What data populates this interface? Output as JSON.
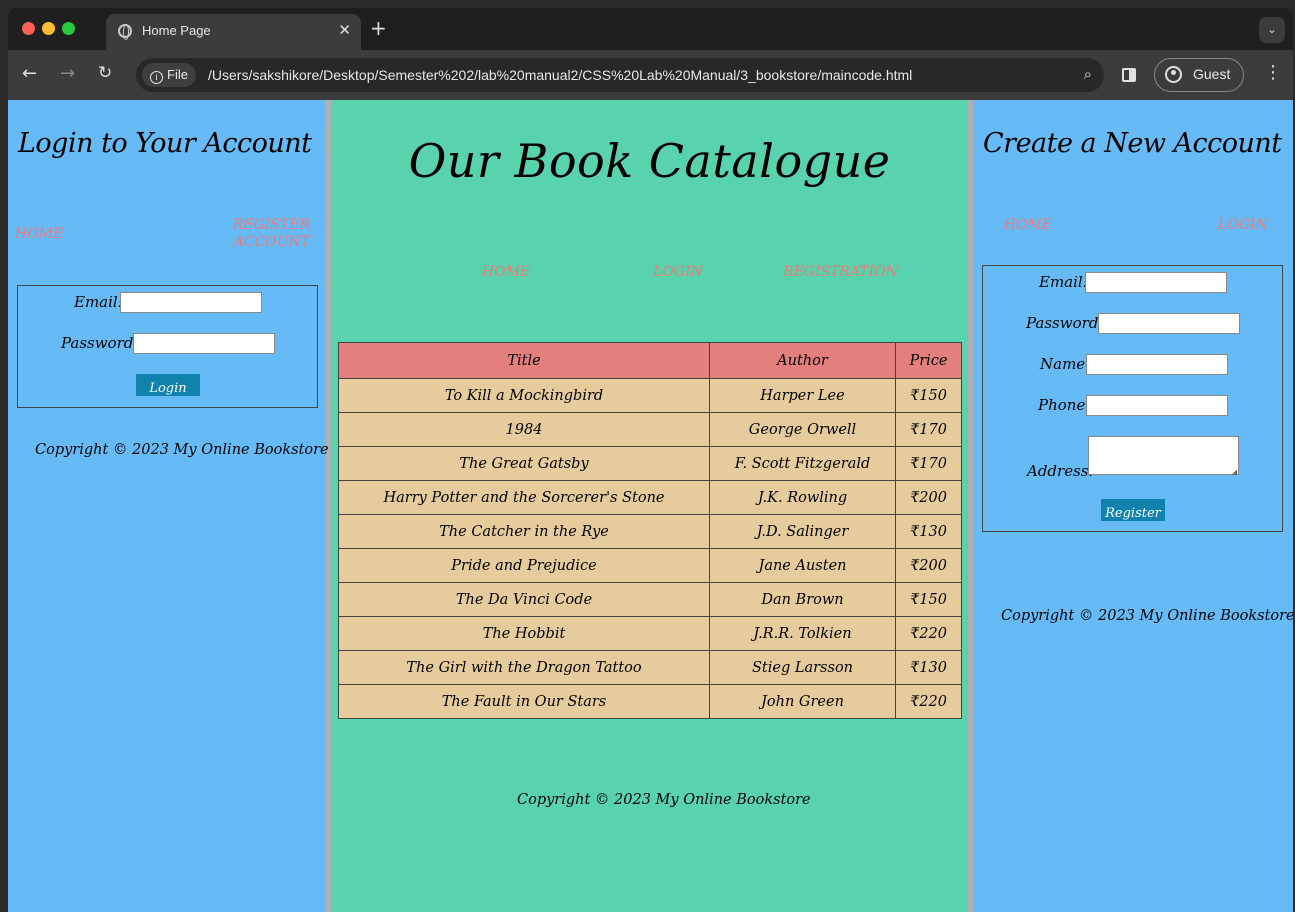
{
  "browser": {
    "tab_title": "Home Page",
    "tab_close": "✕",
    "new_tab": "+",
    "tab_menu": "⌄",
    "back": "←",
    "forward": "→",
    "reload": "↻",
    "info_label": "File",
    "url": "/Users/sakshikore/Desktop/Semester%202/lab%20manual2/CSS%20Lab%20Manual/3_bookstore/maincode.html",
    "zoom": "⌕",
    "profile_label": "Guest",
    "menu": "⋮"
  },
  "login_panel": {
    "heading": "Login to Your Account",
    "links": [
      "HOME",
      "REGISTER ACCOUNT"
    ],
    "email_label": "Email:",
    "password_label": "Password:",
    "submit_label": "Login",
    "copyright": "Copyright © 2023 My Online Bookstore"
  },
  "catalogue": {
    "heading": "Our Book Catalogue",
    "links": [
      "HOME",
      "LOGIN",
      "REGISTRATION"
    ],
    "columns": [
      "Title",
      "Author",
      "Price"
    ],
    "rows": [
      [
        "To Kill a Mockingbird",
        "Harper Lee",
        "₹150"
      ],
      [
        "1984",
        "George Orwell",
        "₹170"
      ],
      [
        "The Great Gatsby",
        "F. Scott Fitzgerald",
        "₹170"
      ],
      [
        "Harry Potter and the Sorcerer's Stone",
        "J.K. Rowling",
        "₹200"
      ],
      [
        "The Catcher in the Rye",
        "J.D. Salinger",
        "₹130"
      ],
      [
        "Pride and Prejudice",
        "Jane Austen",
        "₹200"
      ],
      [
        "The Da Vinci Code",
        "Dan Brown",
        "₹150"
      ],
      [
        "The Hobbit",
        "J.R.R. Tolkien",
        "₹220"
      ],
      [
        "The Girl with the Dragon Tattoo",
        "Stieg Larsson",
        "₹130"
      ],
      [
        "The Fault in Our Stars",
        "John Green",
        "₹220"
      ]
    ],
    "copyright": "Copyright © 2023 My Online Bookstore"
  },
  "register_panel": {
    "heading": "Create a New Account",
    "links": [
      "HOME",
      "LOGIN"
    ],
    "email_label": "Email:",
    "password_label": "Password:",
    "name_label": "Name:",
    "phone_label": "Phone:",
    "address_label": "Address:",
    "submit_label": "Register",
    "copyright": "Copyright © 2023 My Online Bookstore"
  }
}
